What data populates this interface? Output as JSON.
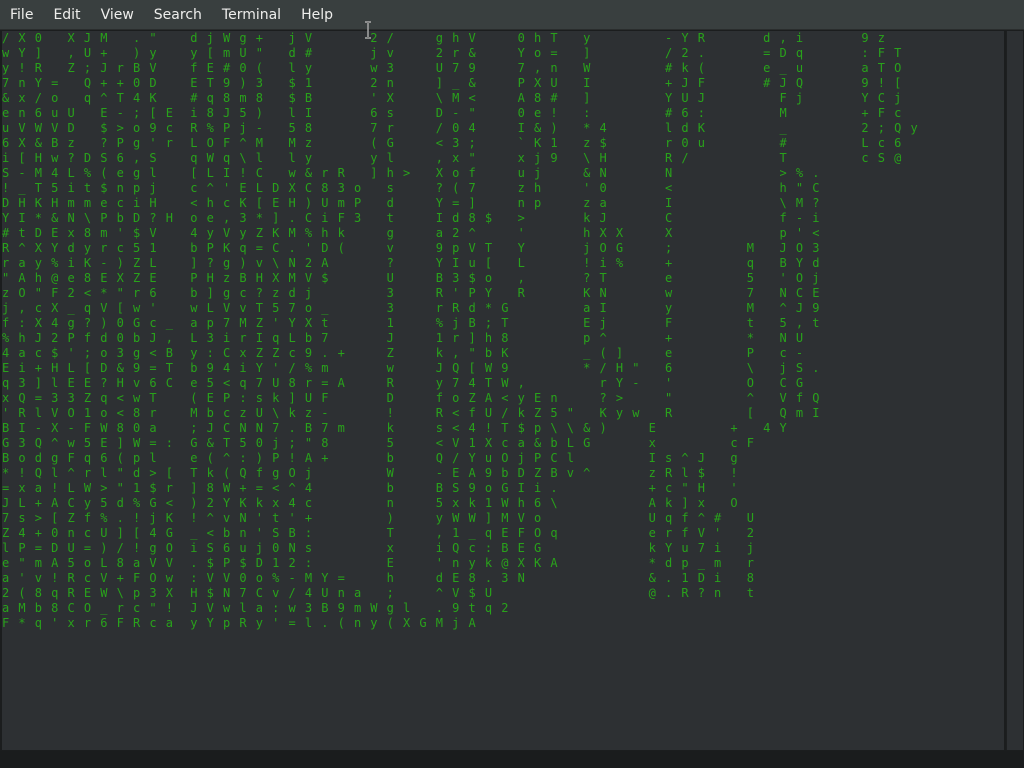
{
  "menubar": {
    "items": [
      "File",
      "Edit",
      "View",
      "Search",
      "Terminal",
      "Help"
    ]
  },
  "terminal": {
    "rows": [
      "/ X 0   X J M   . \"    d j W g +   j V       2 /     g h V     0 h T   y         - Y R       d , i       9 z",
      "w Y ]   , U +   ) y    y [ m U \"   d #       j v     2 r &     Y o =   ]         / 2 .       = D q       : F T",
      "y ! R   Z ; J r B V    f E # 0 (   l y       w 3     U 7 9     7 , n   W         # k (       e _ u       a T O",
      "7 n Y =   Q + + 0 D    E T 9 ) 3   $ 1       2 n     ] _ &     P X U   I         + J F       # J Q       9 ! [",
      "& x / o   q ^ T 4 K    # q 8 m 8   $ B       ' X     \\ M <     A 8 #   ]         Y U J         F j       Y C j",
      "e n 6 u U   E - ; [ E  i 8 J 5 )   l I       6 s     D - \"     0 e !   :         # 6 :         M         + F c",
      "u V W V D   $ > o 9 c  R % P j -   5 8       7 r     / 0 4     I & )   * 4       l d K         _         2 ; Q y",
      "6 X & B z   ? P g ' r  L O F ^ M   M z       ( G     < 3 ;     ` K 1   z $       r 0 u         #         L c 6",
      "i [ H w ? D S 6 , S    q W q \\ l   l y       y l     , x \"     x j 9   \\ H       R /           T         c S @",
      "S - M 4 L % ( e g l    [ L I ! C   w & r R   ] h >   X o f     u j     & N       N             > % .",
      "! _ T 5 i t $ n p j    c ^ ' E L D X C 8 3 o   s     ? ( 7     z h     ' 0       <             h \" C",
      "D H K H m m e c i H    < h c K [ E H ) U m P   d     Y = ]     n p     z a       I             \\ M ?",
      "Y I * & N \\ P b D ? H  o e , 3 * ] . C i F 3   t     I d 8 $   >       k J       C             f - i",
      "# t D E x 8 m ' $ V    4 y V y Z K M % h k     g     a 2 ^     '       h X X     X             p ' <",
      "R ^ X Y d y r c 5 1    b P K q = C . ' D (     v     9 p V T   Y       j O G     ;         M   J O 3",
      "r a y % i K - ) Z L    ] ? g ) v \\ N 2 A       ?     Y I u [   L       ! i %     +         q   B Y d",
      "\" A h @ e 8 E X Z E    P H z B H X M V $       U     B 3 $ o   ,       ? T       e         5   ' O j",
      "z O \" F 2 < * \" r 6    b ] g c ? z d j         3     R ' P Y   R       K N       w         7   N C E",
      "j , c X _ q V [ w '    w L V v T 5 7 o _       3     r R d * G         a I       y         M   ^ J 9",
      "f : X 4 g ? ) 0 G c _  a p 7 M Z ' Y X t       1     % j B ; T         E j       F         t   5 , t",
      "% h J 2 P f d 0 b J ,  L 3 i r I q L b 7       J     1 r ] h 8         p ^       +         *   N U",
      "4 a c $ ' ; o 3 g < B  y : C x Z Z c 9 . +     Z     k , \" b K         _ ( ]     e         P   c -",
      "E i + H L [ D & 9 = T  b 9 4 i Y ' / % m       w     J Q [ W 9         * / H \"   6         \\   j S .",
      "q 3 ] l E E ? H v 6 C  e 5 < q 7 U 8 r = A     R     y 7 4 T W ,         r Y -   '         O   C G",
      "x Q = 3 3 Z q < w T    ( E P : s k ] U F       D     f o Z A < y E n     ? >     \"         ^   V f Q",
      "' R l V O 1 o < 8 r    M b c z U \\ k z -       !     R < f U / k Z 5 \"   K y w   R         [   Q m I",
      "B I - X - F W 8 0 a    ; J C N N 7 . B 7 m     k     s < 4 ! T $ p \\ \\ & )     E         +   4 Y",
      "G 3 Q ^ w 5 E ] W = :  G & T 5 0 j ; \" 8       5     < V 1 X c a & b L G       x         c F",
      "B o d g F q 6 ( p l    e ( ^ : ) P ! A +       b     Q / Y u O j P C l         I s ^ J   g",
      "* ! Q l ^ r l \" d > [  T k ( Q f g O j         W     - E A 9 b D Z B v ^       z R l $   !",
      "= x a ! L W > \" 1 $ r  ] 8 W + = < ^ 4         b     B S 9 o G I i .           + c \" H   '",
      "J L + A C y 5 d % G <  ) 2 Y K k x 4 c         n     5 x k 1 W h 6 \\           A k ] x   O",
      "7 s > [ Z f % . ! j K  ! ^ v N ' t ' +         )     y W W ] M V o             U q f ^ #   U",
      "Z 4 + 0 n c U ] [ 4 G  _ < b n ' S B :         T     , 1 _ q E F O q           e r f V '   2",
      "l P = D U = ) / ! g O  i S 6 u j 0 N s         x     i Q c : B E G             k Y u 7 i   j",
      "e \" m A 5 o L 8 a V V  . $ P $ D 1 2 :         E     ' n y k @ X K A           * d p _ m   r",
      "a ' v ! R c V + F O w  : V V 0 o % - M Y =     h     d E 8 . 3 N               & . 1 D i   8",
      "2 ( 8 q R E W \\ p 3 X  H $ N 7 C v / 4 U n a   ;     ^ V $ U                   @ . R ? n   t",
      "a M b 8 C O _ r c \" !  J V w l a : w 3 B 9 m W g l   . 9 t q 2",
      "F * q ' x r 6 F R c a  y Y p R y ' = l . ( n y ( X G M j A"
    ],
    "highlights": [
      "B",
      "7",
      "#",
      "j",
      "P",
      "B",
      "D",
      "D",
      "$",
      "Y",
      "F",
      "0",
      "E",
      "C",
      "O",
      "E",
      "C",
      "H",
      "r",
      "i",
      "f",
      "k",
      "A",
      "-",
      "5",
      "O",
      "V",
      "k",
      "H",
      "3",
      "c"
    ]
  },
  "colors": {
    "terminal_bg": "#2d3033",
    "text_green": "#29a21b",
    "text_white": "#e9eaeb",
    "menubar_bg": "#393f3f"
  }
}
